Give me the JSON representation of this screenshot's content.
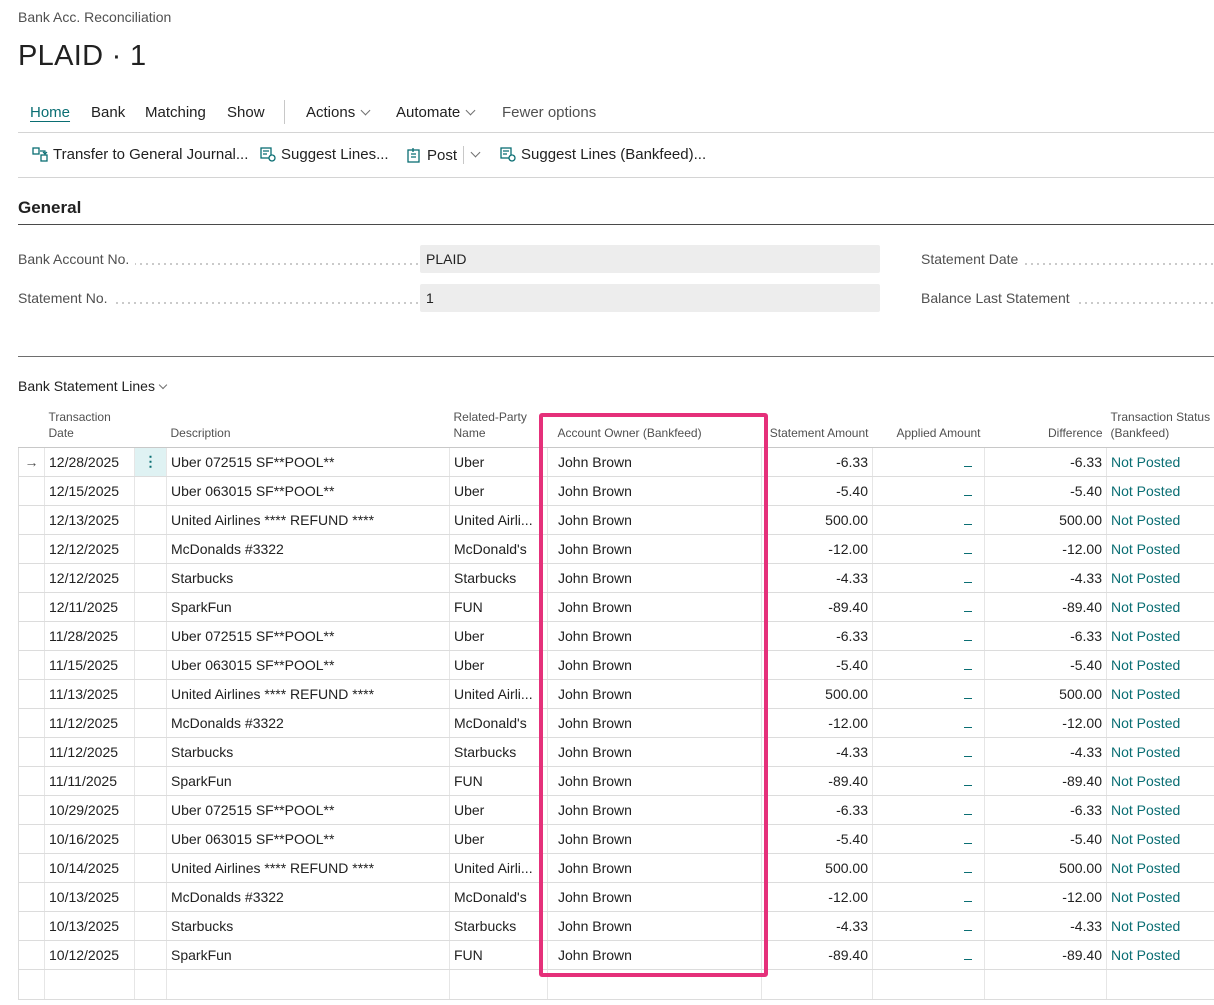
{
  "breadcrumb": "Bank Acc. Reconciliation",
  "title": "PLAID · 1",
  "action_tabs": {
    "home": "Home",
    "bank": "Bank",
    "matching": "Matching",
    "show": "Show",
    "actions": "Actions",
    "automate": "Automate",
    "fewer": "Fewer options"
  },
  "toolbar": {
    "transfer": "Transfer to General Journal...",
    "suggest": "Suggest Lines...",
    "post": "Post",
    "suggest_bankfeed": "Suggest Lines (Bankfeed)..."
  },
  "general": {
    "title": "General",
    "bank_account_label": "Bank Account No.",
    "bank_account_value": "PLAID",
    "statement_no_label": "Statement No.",
    "statement_no_value": "1",
    "statement_date_label": "Statement Date",
    "balance_last_label": "Balance Last Statement"
  },
  "lines": {
    "title": "Bank Statement Lines",
    "headers": {
      "date": "Transaction Date",
      "description": "Description",
      "related": "Related-Party Name",
      "owner": "Account Owner (Bankfeed)",
      "amount": "Statement Amount",
      "applied": "Applied Amount",
      "difference": "Difference",
      "status": "Transaction Status (Bankfeed)"
    },
    "rows": [
      {
        "date": "12/28/2025",
        "description": "Uber 072515 SF**POOL**",
        "related": "Uber",
        "owner": "John Brown",
        "amount": "-6.33",
        "difference": "-6.33",
        "status": "Not Posted"
      },
      {
        "date": "12/15/2025",
        "description": "Uber 063015 SF**POOL**",
        "related": "Uber",
        "owner": "John Brown",
        "amount": "-5.40",
        "difference": "-5.40",
        "status": "Not Posted"
      },
      {
        "date": "12/13/2025",
        "description": "United Airlines **** REFUND ****",
        "related": "United Airli...",
        "owner": "John Brown",
        "amount": "500.00",
        "difference": "500.00",
        "status": "Not Posted"
      },
      {
        "date": "12/12/2025",
        "description": "McDonalds #3322",
        "related": "McDonald's",
        "owner": "John Brown",
        "amount": "-12.00",
        "difference": "-12.00",
        "status": "Not Posted"
      },
      {
        "date": "12/12/2025",
        "description": "Starbucks",
        "related": "Starbucks",
        "owner": "John Brown",
        "amount": "-4.33",
        "difference": "-4.33",
        "status": "Not Posted"
      },
      {
        "date": "12/11/2025",
        "description": "SparkFun",
        "related": "FUN",
        "owner": "John Brown",
        "amount": "-89.40",
        "difference": "-89.40",
        "status": "Not Posted"
      },
      {
        "date": "11/28/2025",
        "description": "Uber 072515 SF**POOL**",
        "related": "Uber",
        "owner": "John Brown",
        "amount": "-6.33",
        "difference": "-6.33",
        "status": "Not Posted"
      },
      {
        "date": "11/15/2025",
        "description": "Uber 063015 SF**POOL**",
        "related": "Uber",
        "owner": "John Brown",
        "amount": "-5.40",
        "difference": "-5.40",
        "status": "Not Posted"
      },
      {
        "date": "11/13/2025",
        "description": "United Airlines **** REFUND ****",
        "related": "United Airli...",
        "owner": "John Brown",
        "amount": "500.00",
        "difference": "500.00",
        "status": "Not Posted"
      },
      {
        "date": "11/12/2025",
        "description": "McDonalds #3322",
        "related": "McDonald's",
        "owner": "John Brown",
        "amount": "-12.00",
        "difference": "-12.00",
        "status": "Not Posted"
      },
      {
        "date": "11/12/2025",
        "description": "Starbucks",
        "related": "Starbucks",
        "owner": "John Brown",
        "amount": "-4.33",
        "difference": "-4.33",
        "status": "Not Posted"
      },
      {
        "date": "11/11/2025",
        "description": "SparkFun",
        "related": "FUN",
        "owner": "John Brown",
        "amount": "-89.40",
        "difference": "-89.40",
        "status": "Not Posted"
      },
      {
        "date": "10/29/2025",
        "description": "Uber 072515 SF**POOL**",
        "related": "Uber",
        "owner": "John Brown",
        "amount": "-6.33",
        "difference": "-6.33",
        "status": "Not Posted"
      },
      {
        "date": "10/16/2025",
        "description": "Uber 063015 SF**POOL**",
        "related": "Uber",
        "owner": "John Brown",
        "amount": "-5.40",
        "difference": "-5.40",
        "status": "Not Posted"
      },
      {
        "date": "10/14/2025",
        "description": "United Airlines **** REFUND ****",
        "related": "United Airli...",
        "owner": "John Brown",
        "amount": "500.00",
        "difference": "500.00",
        "status": "Not Posted"
      },
      {
        "date": "10/13/2025",
        "description": "McDonalds #3322",
        "related": "McDonald's",
        "owner": "John Brown",
        "amount": "-12.00",
        "difference": "-12.00",
        "status": "Not Posted"
      },
      {
        "date": "10/13/2025",
        "description": "Starbucks",
        "related": "Starbucks",
        "owner": "John Brown",
        "amount": "-4.33",
        "difference": "-4.33",
        "status": "Not Posted"
      },
      {
        "date": "10/12/2025",
        "description": "SparkFun",
        "related": "FUN",
        "owner": "John Brown",
        "amount": "-89.40",
        "difference": "-89.40",
        "status": "Not Posted"
      }
    ]
  },
  "colors": {
    "accent": "#0a6e73",
    "highlight": "#e5307a"
  }
}
